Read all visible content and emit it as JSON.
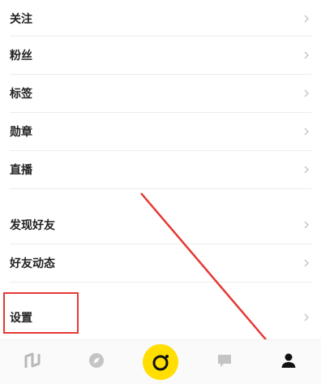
{
  "menu": {
    "items": [
      {
        "label": "关注"
      },
      {
        "label": "粉丝"
      },
      {
        "label": "标签"
      },
      {
        "label": "勋章"
      },
      {
        "label": "直播"
      },
      {
        "label": "发现好友"
      },
      {
        "label": "好友动态"
      },
      {
        "label": "设置"
      }
    ]
  },
  "annotation": {
    "color": "#e53935"
  },
  "tabbar": {
    "tabs": [
      {
        "icon": "logo-n-icon"
      },
      {
        "icon": "compass-icon"
      },
      {
        "icon": "camera-icon",
        "color": "#ffde00"
      },
      {
        "icon": "chat-bubble-icon"
      },
      {
        "icon": "person-icon",
        "active": true
      }
    ]
  }
}
